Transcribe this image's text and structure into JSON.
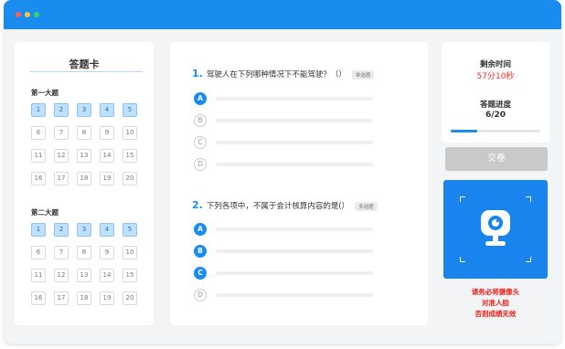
{
  "window": {
    "accent": "#1a8cf0"
  },
  "answer_card": {
    "title": "答题卡",
    "sections": [
      {
        "label": "第一大题",
        "numbers": [
          "1",
          "2",
          "3",
          "4",
          "5",
          "6",
          "7",
          "8",
          "9",
          "10",
          "11",
          "12",
          "13",
          "14",
          "15",
          "16",
          "17",
          "18",
          "19",
          "20"
        ],
        "done_count": 5
      },
      {
        "label": "第二大题",
        "numbers": [
          "1",
          "2",
          "3",
          "4",
          "5",
          "6",
          "7",
          "8",
          "9",
          "10",
          "11",
          "12",
          "13",
          "14",
          "15",
          "16",
          "17",
          "18",
          "19",
          "20"
        ],
        "done_count": 5
      }
    ]
  },
  "questions": [
    {
      "number": "1.",
      "text": "驾驶人在下列哪种情况下不能驾驶？（）",
      "type": "单选题",
      "options": [
        {
          "letter": "A",
          "selected": true
        },
        {
          "letter": "B",
          "selected": false
        },
        {
          "letter": "C",
          "selected": false
        },
        {
          "letter": "D",
          "selected": false
        }
      ]
    },
    {
      "number": "2.",
      "text": "下列各项中，不属于会计核算内容的是(）",
      "type": "多选题",
      "options": [
        {
          "letter": "A",
          "selected": true
        },
        {
          "letter": "B",
          "selected": true
        },
        {
          "letter": "C",
          "selected": true
        },
        {
          "letter": "D",
          "selected": false
        }
      ]
    }
  ],
  "status": {
    "time_label": "剩余时间",
    "time_value": "57分10秒",
    "progress_label": "答题进度",
    "progress_value": "6/20",
    "progress_fraction": 0.3
  },
  "submit_label": "交卷",
  "camera": {
    "icon": "webcam-icon"
  },
  "warning": [
    "请务必将摄像头",
    "对准人脸",
    "否则成绩无效"
  ],
  "colors": {
    "selected": "#1a8cf0",
    "done": "#bfe0ff",
    "warning": "#e8211e",
    "time": "#f02d2d",
    "disabled": "#c9c9c9"
  }
}
